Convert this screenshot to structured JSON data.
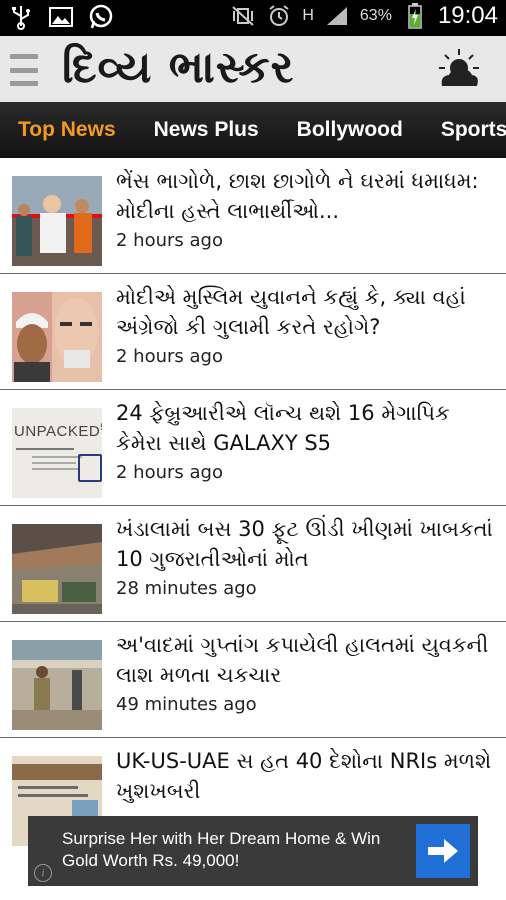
{
  "status_bar": {
    "left_icons": [
      "usb-icon",
      "image-icon",
      "whatsapp-icon"
    ],
    "battery_percent": "63%",
    "time": "19:04",
    "network_label": "H"
  },
  "app": {
    "logo": "દિવ્ય ભાસ્કર"
  },
  "tabs": [
    {
      "label": "Top News",
      "active": true
    },
    {
      "label": "News Plus",
      "active": false
    },
    {
      "label": "Bollywood",
      "active": false
    },
    {
      "label": "Sports",
      "active": false
    }
  ],
  "news": [
    {
      "title": "ભેંસ ભાગોળે, છાશ છાગોળે ને ઘરમાં ધમાધમ: મોદીના હસ્તે લાભાર્થીઓ...",
      "time": "2 hours ago"
    },
    {
      "title": "મોદીએ મુસ્લિમ યુવાનને કહ્યું કે, ક્યા વહાં અંગ્રેજો કી ગુલામી કરતે રહોગે?",
      "time": "2 hours ago"
    },
    {
      "title": "24 ફેબ્રુઆરીએ લૉન્ચ થશે 16 મેગાપિક કેમેરા સાથે GALAXY S5",
      "time": "2 hours ago"
    },
    {
      "title": "ખંડાલામાં બસ 30 ફૂટ ઊંડી ખીણમાં ખાબકતાં 10 ગુજરાતીઓનાં મોત",
      "time": "28 minutes ago"
    },
    {
      "title": "અ'વાદમાં ગુપ્તાંગ કપાયેલી હાલતમાં યુવકની લાશ મળતા ચકચાર",
      "time": "49 minutes ago"
    },
    {
      "title": "UK-US-UAE સ   હત 40 દેશોના NRIs મળશે ખુશખબરી",
      "time": ""
    }
  ],
  "thumb3_text": "UNPACKED",
  "thumb3_sup": "5",
  "ad": {
    "text": "Surprise Her with Her Dream Home & Win Gold Worth Rs. 49,000!",
    "info_label": "i"
  }
}
